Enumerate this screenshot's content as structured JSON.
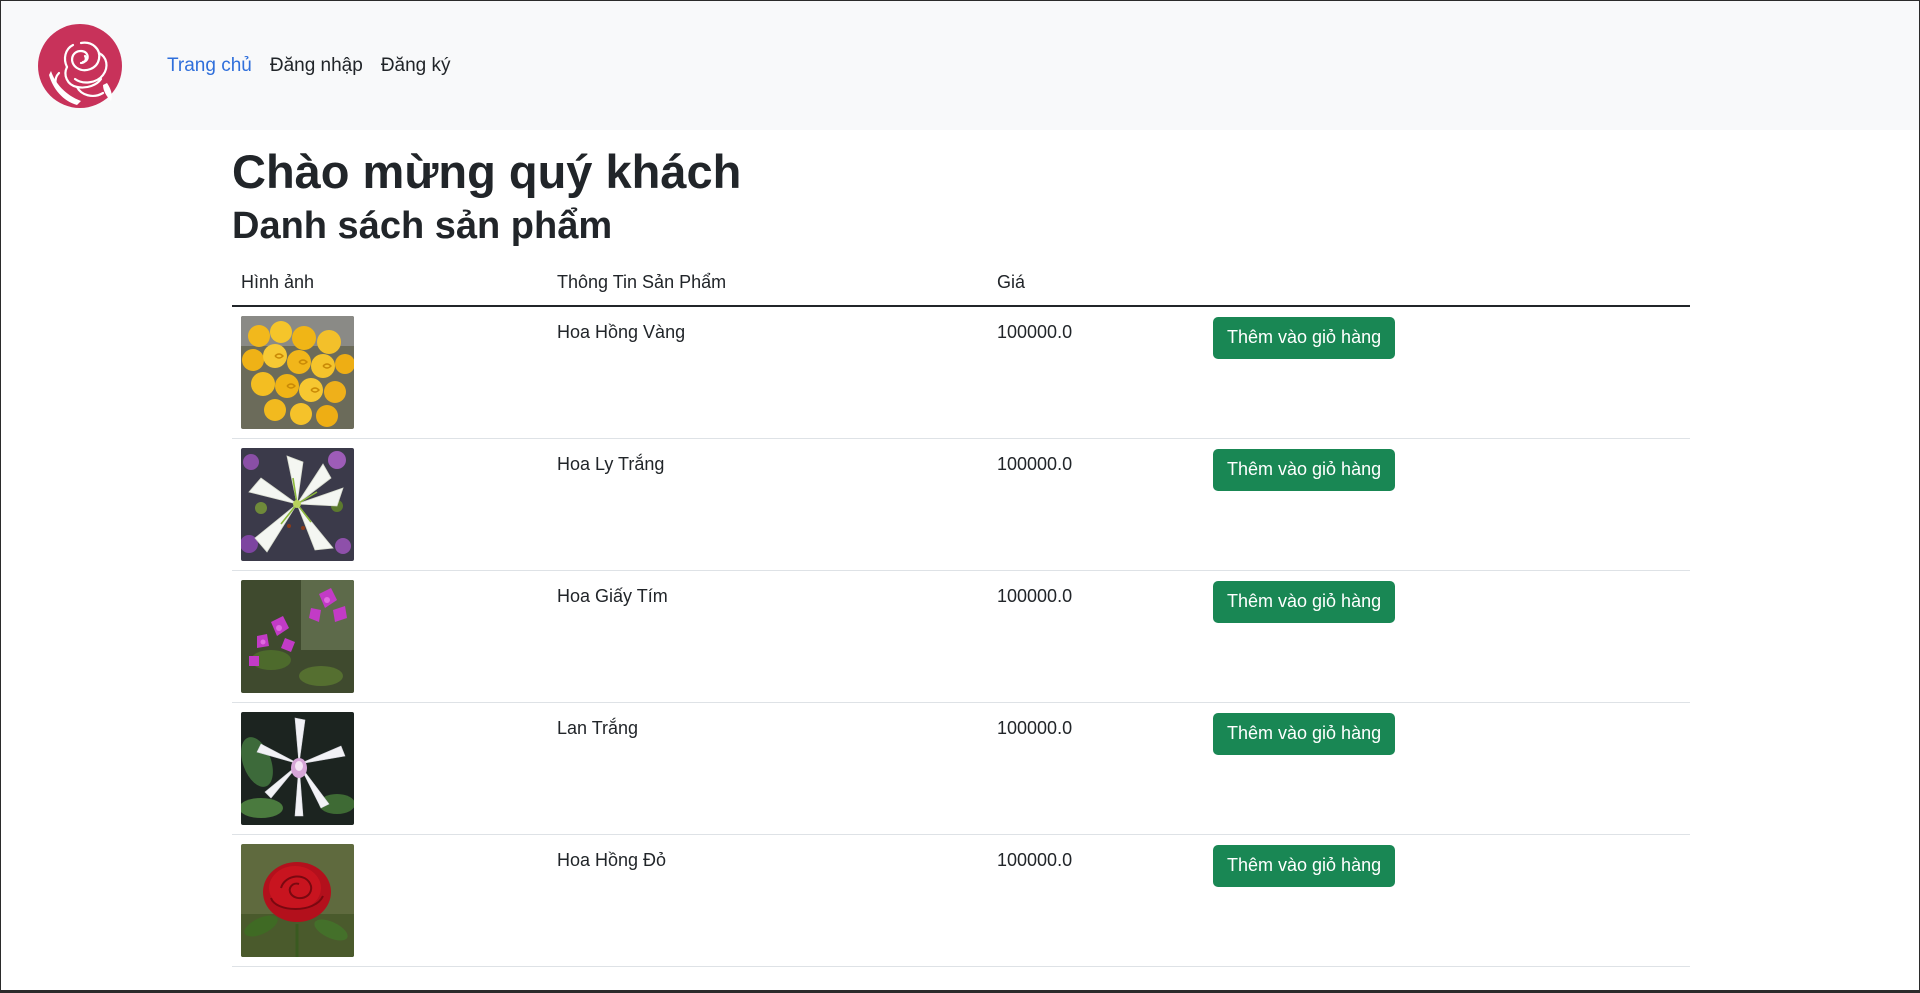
{
  "nav": {
    "items": [
      {
        "label": "Trang chủ",
        "active": true
      },
      {
        "label": "Đăng nhập",
        "active": false
      },
      {
        "label": "Đăng ký",
        "active": false
      }
    ],
    "logo_icon": "rose-logo-icon",
    "brand_color": "#c8325a"
  },
  "main": {
    "title": "Chào mừng quý khách",
    "subtitle": "Danh sách sản phẩm"
  },
  "table": {
    "headers": {
      "image": "Hình ảnh",
      "info": "Thông Tin Sản Phẩm",
      "price": "Giá",
      "action": ""
    },
    "rows": [
      {
        "name": "Hoa Hồng Vàng",
        "price": "100000.0",
        "button": "Thêm vào giỏ hàng",
        "image_icon": "yellow-rose-photo"
      },
      {
        "name": "Hoa Ly Trắng",
        "price": "100000.0",
        "button": "Thêm vào giỏ hàng",
        "image_icon": "white-lily-photo"
      },
      {
        "name": "Hoa Giấy Tím",
        "price": "100000.0",
        "button": "Thêm vào giỏ hàng",
        "image_icon": "purple-bougainvillea-photo"
      },
      {
        "name": "Lan Trắng",
        "price": "100000.0",
        "button": "Thêm vào giỏ hàng",
        "image_icon": "white-orchid-photo"
      },
      {
        "name": "Hoa Hồng Đỏ",
        "price": "100000.0",
        "button": "Thêm vào giỏ hàng",
        "image_icon": "red-rose-photo"
      }
    ]
  },
  "colors": {
    "accent_link": "#2f6fdb",
    "button_green": "#198754",
    "navbar_bg": "#f8f9fa"
  }
}
